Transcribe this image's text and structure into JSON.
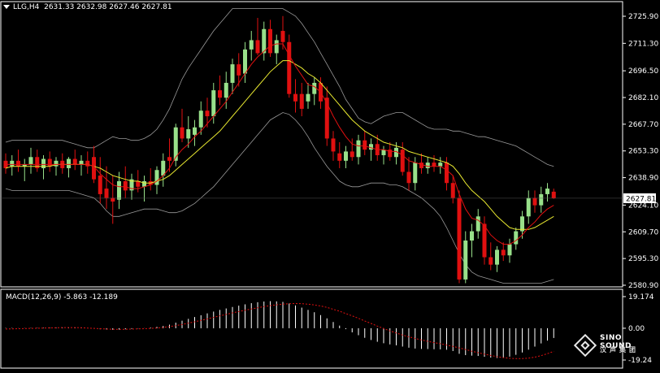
{
  "header": {
    "symbol_tf": "LLG,H4",
    "ohlc": "2631.33 2632.98 2627.46 2627.81"
  },
  "macd_header": "MACD(12,26,9) -5.863 -12.189",
  "logo": {
    "brand": "SINO SOUND",
    "brand_cn": "汉声集团"
  },
  "colors": {
    "background": "#000000",
    "bull": "#98e08a",
    "bear": "#e01010",
    "ma_fast": "#e01010",
    "ma_slow": "#e8e830",
    "bands": "#9a9a9a",
    "macd_hist": "#ffffff",
    "macd_signal": "#e01010",
    "axis": "#ffffff",
    "last_price_tag_bg": "#ffffff",
    "last_price_tag_fg": "#000000"
  },
  "chart_data": [
    {
      "type": "candlestick",
      "title": "LLG,H4",
      "ylim": [
        2578,
        2730
      ],
      "y_ticks": [
        "2725.90",
        "2711.30",
        "2696.50",
        "2682.10",
        "2667.70",
        "2653.30",
        "2638.90",
        "2624.10",
        "2609.70",
        "2595.30",
        "2580.90"
      ],
      "last_price": "2627.81",
      "candles": [
        {
          "o": 2648,
          "h": 2652,
          "l": 2641,
          "c": 2644
        },
        {
          "o": 2645,
          "h": 2651,
          "l": 2640,
          "c": 2648
        },
        {
          "o": 2648,
          "h": 2654,
          "l": 2642,
          "c": 2645
        },
        {
          "o": 2645,
          "h": 2649,
          "l": 2637,
          "c": 2646
        },
        {
          "o": 2646,
          "h": 2655,
          "l": 2641,
          "c": 2650
        },
        {
          "o": 2650,
          "h": 2654,
          "l": 2642,
          "c": 2644
        },
        {
          "o": 2644,
          "h": 2651,
          "l": 2638,
          "c": 2649
        },
        {
          "o": 2649,
          "h": 2653,
          "l": 2642,
          "c": 2645
        },
        {
          "o": 2645,
          "h": 2650,
          "l": 2640,
          "c": 2648
        },
        {
          "o": 2648,
          "h": 2652,
          "l": 2641,
          "c": 2644
        },
        {
          "o": 2644,
          "h": 2650,
          "l": 2639,
          "c": 2649
        },
        {
          "o": 2649,
          "h": 2654,
          "l": 2643,
          "c": 2646
        },
        {
          "o": 2646,
          "h": 2651,
          "l": 2640,
          "c": 2648
        },
        {
          "o": 2648,
          "h": 2653,
          "l": 2641,
          "c": 2645
        },
        {
          "o": 2650,
          "h": 2656,
          "l": 2636,
          "c": 2638
        },
        {
          "o": 2640,
          "h": 2650,
          "l": 2625,
          "c": 2630
        },
        {
          "o": 2633,
          "h": 2645,
          "l": 2622,
          "c": 2628
        },
        {
          "o": 2628,
          "h": 2640,
          "l": 2614,
          "c": 2626
        },
        {
          "o": 2627,
          "h": 2642,
          "l": 2622,
          "c": 2637
        },
        {
          "o": 2637,
          "h": 2645,
          "l": 2628,
          "c": 2632
        },
        {
          "o": 2632,
          "h": 2641,
          "l": 2627,
          "c": 2638
        },
        {
          "o": 2637,
          "h": 2643,
          "l": 2631,
          "c": 2634
        },
        {
          "o": 2634,
          "h": 2640,
          "l": 2626,
          "c": 2637
        },
        {
          "o": 2637,
          "h": 2644,
          "l": 2632,
          "c": 2635
        },
        {
          "o": 2635,
          "h": 2645,
          "l": 2630,
          "c": 2643
        },
        {
          "o": 2640,
          "h": 2652,
          "l": 2634,
          "c": 2648
        },
        {
          "o": 2650,
          "h": 2660,
          "l": 2642,
          "c": 2648
        },
        {
          "o": 2648,
          "h": 2668,
          "l": 2645,
          "c": 2666
        },
        {
          "o": 2666,
          "h": 2676,
          "l": 2658,
          "c": 2660
        },
        {
          "o": 2660,
          "h": 2672,
          "l": 2655,
          "c": 2665
        },
        {
          "o": 2662,
          "h": 2670,
          "l": 2656,
          "c": 2666
        },
        {
          "o": 2666,
          "h": 2680,
          "l": 2662,
          "c": 2675
        },
        {
          "o": 2675,
          "h": 2682,
          "l": 2666,
          "c": 2672
        },
        {
          "o": 2672,
          "h": 2690,
          "l": 2668,
          "c": 2686
        },
        {
          "o": 2686,
          "h": 2694,
          "l": 2678,
          "c": 2682
        },
        {
          "o": 2682,
          "h": 2696,
          "l": 2676,
          "c": 2690
        },
        {
          "o": 2690,
          "h": 2703,
          "l": 2684,
          "c": 2700
        },
        {
          "o": 2700,
          "h": 2706,
          "l": 2688,
          "c": 2694
        },
        {
          "o": 2695,
          "h": 2712,
          "l": 2690,
          "c": 2708
        },
        {
          "o": 2708,
          "h": 2718,
          "l": 2702,
          "c": 2713
        },
        {
          "o": 2713,
          "h": 2725,
          "l": 2705,
          "c": 2706
        },
        {
          "o": 2706,
          "h": 2723,
          "l": 2702,
          "c": 2719
        },
        {
          "o": 2719,
          "h": 2724,
          "l": 2704,
          "c": 2706
        },
        {
          "o": 2706,
          "h": 2716,
          "l": 2700,
          "c": 2713
        },
        {
          "o": 2718,
          "h": 2726,
          "l": 2708,
          "c": 2712
        },
        {
          "o": 2712,
          "h": 2716,
          "l": 2682,
          "c": 2684
        },
        {
          "o": 2684,
          "h": 2692,
          "l": 2674,
          "c": 2680
        },
        {
          "o": 2684,
          "h": 2690,
          "l": 2672,
          "c": 2676
        },
        {
          "o": 2680,
          "h": 2690,
          "l": 2676,
          "c": 2684
        },
        {
          "o": 2684,
          "h": 2693,
          "l": 2678,
          "c": 2690
        },
        {
          "o": 2690,
          "h": 2693,
          "l": 2676,
          "c": 2680
        },
        {
          "o": 2682,
          "h": 2688,
          "l": 2656,
          "c": 2660
        },
        {
          "o": 2660,
          "h": 2664,
          "l": 2648,
          "c": 2653
        },
        {
          "o": 2652,
          "h": 2658,
          "l": 2644,
          "c": 2648
        },
        {
          "o": 2648,
          "h": 2656,
          "l": 2644,
          "c": 2653
        },
        {
          "o": 2653,
          "h": 2660,
          "l": 2648,
          "c": 2650
        },
        {
          "o": 2650,
          "h": 2662,
          "l": 2646,
          "c": 2659
        },
        {
          "o": 2659,
          "h": 2664,
          "l": 2651,
          "c": 2654
        },
        {
          "o": 2654,
          "h": 2660,
          "l": 2648,
          "c": 2657
        },
        {
          "o": 2657,
          "h": 2662,
          "l": 2648,
          "c": 2651
        },
        {
          "o": 2651,
          "h": 2656,
          "l": 2646,
          "c": 2654
        },
        {
          "o": 2654,
          "h": 2658,
          "l": 2648,
          "c": 2650
        },
        {
          "o": 2650,
          "h": 2658,
          "l": 2646,
          "c": 2655
        },
        {
          "o": 2654,
          "h": 2658,
          "l": 2640,
          "c": 2642
        },
        {
          "o": 2642,
          "h": 2650,
          "l": 2632,
          "c": 2636
        },
        {
          "o": 2636,
          "h": 2650,
          "l": 2632,
          "c": 2647
        },
        {
          "o": 2647,
          "h": 2652,
          "l": 2641,
          "c": 2644
        },
        {
          "o": 2644,
          "h": 2650,
          "l": 2641,
          "c": 2647
        },
        {
          "o": 2647,
          "h": 2651,
          "l": 2642,
          "c": 2645
        },
        {
          "o": 2645,
          "h": 2650,
          "l": 2641,
          "c": 2647
        },
        {
          "o": 2647,
          "h": 2650,
          "l": 2632,
          "c": 2636
        },
        {
          "o": 2636,
          "h": 2640,
          "l": 2625,
          "c": 2628
        },
        {
          "o": 2628,
          "h": 2632,
          "l": 2582,
          "c": 2584
        },
        {
          "o": 2584,
          "h": 2610,
          "l": 2582,
          "c": 2605
        },
        {
          "o": 2605,
          "h": 2614,
          "l": 2596,
          "c": 2610
        },
        {
          "o": 2610,
          "h": 2622,
          "l": 2606,
          "c": 2618
        },
        {
          "o": 2614,
          "h": 2618,
          "l": 2592,
          "c": 2596
        },
        {
          "o": 2596,
          "h": 2604,
          "l": 2589,
          "c": 2592
        },
        {
          "o": 2592,
          "h": 2602,
          "l": 2588,
          "c": 2600
        },
        {
          "o": 2600,
          "h": 2604,
          "l": 2594,
          "c": 2597
        },
        {
          "o": 2597,
          "h": 2606,
          "l": 2593,
          "c": 2603
        },
        {
          "o": 2603,
          "h": 2612,
          "l": 2600,
          "c": 2610
        },
        {
          "o": 2610,
          "h": 2621,
          "l": 2606,
          "c": 2618
        },
        {
          "o": 2618,
          "h": 2632,
          "l": 2614,
          "c": 2628
        },
        {
          "o": 2628,
          "h": 2632,
          "l": 2620,
          "c": 2624
        },
        {
          "o": 2624,
          "h": 2634,
          "l": 2620,
          "c": 2630
        },
        {
          "o": 2630,
          "h": 2636,
          "l": 2626,
          "c": 2633
        },
        {
          "o": 2631.33,
          "h": 2632.98,
          "l": 2627.46,
          "c": 2627.81
        }
      ],
      "ma_fast": [
        2646,
        2646,
        2646,
        2646,
        2646,
        2646,
        2646,
        2646,
        2646,
        2646,
        2646,
        2646,
        2646,
        2646,
        2645,
        2641,
        2638,
        2635,
        2634,
        2634,
        2633,
        2633,
        2634,
        2635,
        2637,
        2640,
        2644,
        2650,
        2654,
        2657,
        2661,
        2664,
        2668,
        2672,
        2676,
        2680,
        2685,
        2690,
        2695,
        2700,
        2704,
        2707,
        2710,
        2711,
        2711,
        2705,
        2699,
        2694,
        2689,
        2688,
        2685,
        2679,
        2672,
        2666,
        2661,
        2657,
        2656,
        2656,
        2655,
        2654,
        2654,
        2653,
        2653,
        2651,
        2648,
        2647,
        2646,
        2645,
        2645,
        2645,
        2643,
        2640,
        2630,
        2622,
        2617,
        2616,
        2613,
        2608,
        2605,
        2603,
        2603,
        2605,
        2608,
        2612,
        2615,
        2619,
        2622,
        2624
      ],
      "ma_slow": [
        2644,
        2645,
        2645,
        2645,
        2645,
        2645,
        2645,
        2645,
        2646,
        2646,
        2646,
        2646,
        2646,
        2646,
        2645,
        2644,
        2642,
        2640,
        2639,
        2638,
        2637,
        2637,
        2636,
        2636,
        2637,
        2638,
        2640,
        2643,
        2646,
        2649,
        2652,
        2655,
        2658,
        2661,
        2664,
        2668,
        2672,
        2676,
        2680,
        2684,
        2688,
        2692,
        2696,
        2699,
        2702,
        2702,
        2700,
        2698,
        2695,
        2693,
        2690,
        2686,
        2682,
        2678,
        2674,
        2670,
        2667,
        2664,
        2662,
        2660,
        2658,
        2657,
        2656,
        2655,
        2653,
        2652,
        2651,
        2650,
        2649,
        2648,
        2647,
        2645,
        2641,
        2636,
        2632,
        2629,
        2626,
        2622,
        2618,
        2615,
        2612,
        2611,
        2611,
        2611,
        2612,
        2614,
        2616,
        2618
      ],
      "band_upper": [
        2658,
        2659,
        2659,
        2659,
        2659,
        2659,
        2659,
        2659,
        2659,
        2659,
        2658,
        2657,
        2656,
        2655,
        2655,
        2657,
        2659,
        2661,
        2660,
        2660,
        2659,
        2659,
        2660,
        2662,
        2665,
        2670,
        2676,
        2684,
        2692,
        2698,
        2703,
        2708,
        2713,
        2718,
        2722,
        2726,
        2730,
        2730,
        2730,
        2730,
        2730,
        2730,
        2730,
        2730,
        2730,
        2728,
        2726,
        2722,
        2717,
        2712,
        2706,
        2700,
        2694,
        2688,
        2681,
        2676,
        2671,
        2669,
        2668,
        2670,
        2672,
        2673,
        2674,
        2674,
        2672,
        2670,
        2668,
        2666,
        2665,
        2665,
        2665,
        2664,
        2664,
        2663,
        2662,
        2661,
        2661,
        2660,
        2659,
        2658,
        2657,
        2656,
        2654,
        2652,
        2650,
        2648,
        2646,
        2645
      ],
      "band_lower": [
        2633,
        2632,
        2632,
        2632,
        2632,
        2632,
        2632,
        2632,
        2632,
        2632,
        2632,
        2631,
        2630,
        2629,
        2628,
        2625,
        2621,
        2618,
        2618,
        2619,
        2620,
        2621,
        2622,
        2622,
        2622,
        2621,
        2620,
        2620,
        2621,
        2623,
        2625,
        2628,
        2631,
        2634,
        2638,
        2642,
        2646,
        2650,
        2654,
        2658,
        2662,
        2666,
        2670,
        2672,
        2674,
        2673,
        2670,
        2666,
        2661,
        2655,
        2650,
        2645,
        2641,
        2637,
        2635,
        2634,
        2634,
        2635,
        2636,
        2636,
        2636,
        2635,
        2635,
        2634,
        2632,
        2630,
        2628,
        2625,
        2622,
        2618,
        2612,
        2605,
        2598,
        2592,
        2588,
        2586,
        2585,
        2584,
        2583,
        2582,
        2582,
        2582,
        2582,
        2582,
        2582,
        2582,
        2583,
        2584
      ]
    },
    {
      "type": "macd",
      "title": "MACD(12,26,9) -5.863 -12.189",
      "ylim": [
        -19.24,
        19.174
      ],
      "y_ticks": [
        "19.174",
        "0.00",
        "-19.24"
      ],
      "histogram": [
        0.2,
        0.2,
        0.1,
        0.1,
        0.2,
        0.2,
        0.3,
        0.3,
        0.4,
        0.4,
        0.4,
        0.4,
        0.3,
        0.1,
        -0.3,
        -0.6,
        -0.8,
        -0.9,
        -0.8,
        -0.6,
        -0.4,
        -0.2,
        0.1,
        0.4,
        0.8,
        1.4,
        2.2,
        3.4,
        4.6,
        5.7,
        6.8,
        7.9,
        9.0,
        10.1,
        11.1,
        12.0,
        12.9,
        13.7,
        14.5,
        15.2,
        15.8,
        16.2,
        16.4,
        16.3,
        16.0,
        15.0,
        13.8,
        12.5,
        11.1,
        9.7,
        8.0,
        6.0,
        3.8,
        1.6,
        -0.5,
        -2.5,
        -4.2,
        -5.8,
        -7.1,
        -8.2,
        -9.1,
        -9.8,
        -10.4,
        -11.1,
        -11.8,
        -12.3,
        -12.5,
        -12.6,
        -12.7,
        -12.8,
        -13.0,
        -13.8,
        -15.5,
        -16.3,
        -16.6,
        -16.8,
        -17.3,
        -17.8,
        -18.0,
        -17.8,
        -17.2,
        -16.1,
        -14.7,
        -13.0,
        -11.1,
        -9.2,
        -7.5,
        -5.9
      ],
      "signal": [
        -0.5,
        -0.4,
        -0.3,
        -0.2,
        -0.1,
        0.0,
        0.1,
        0.2,
        0.3,
        0.4,
        0.4,
        0.4,
        0.3,
        0.1,
        -0.1,
        -0.3,
        -0.5,
        -0.6,
        -0.6,
        -0.6,
        -0.5,
        -0.4,
        -0.3,
        -0.1,
        0.1,
        0.5,
        1.0,
        1.6,
        2.3,
        3.1,
        3.9,
        4.8,
        5.7,
        6.6,
        7.5,
        8.4,
        9.3,
        10.1,
        10.9,
        11.7,
        12.4,
        13.1,
        13.7,
        14.2,
        14.6,
        14.9,
        15.0,
        14.9,
        14.6,
        14.1,
        13.5,
        12.6,
        11.5,
        10.3,
        8.9,
        7.5,
        6.0,
        4.4,
        2.9,
        1.3,
        -0.2,
        -1.6,
        -2.9,
        -4.1,
        -5.2,
        -6.2,
        -7.1,
        -7.9,
        -8.7,
        -9.4,
        -10.2,
        -11.0,
        -11.9,
        -12.9,
        -13.9,
        -14.8,
        -15.7,
        -16.5,
        -17.2,
        -17.8,
        -18.2,
        -18.4,
        -18.4,
        -18.1,
        -17.5,
        -16.6,
        -15.4,
        -14.0
      ]
    }
  ]
}
